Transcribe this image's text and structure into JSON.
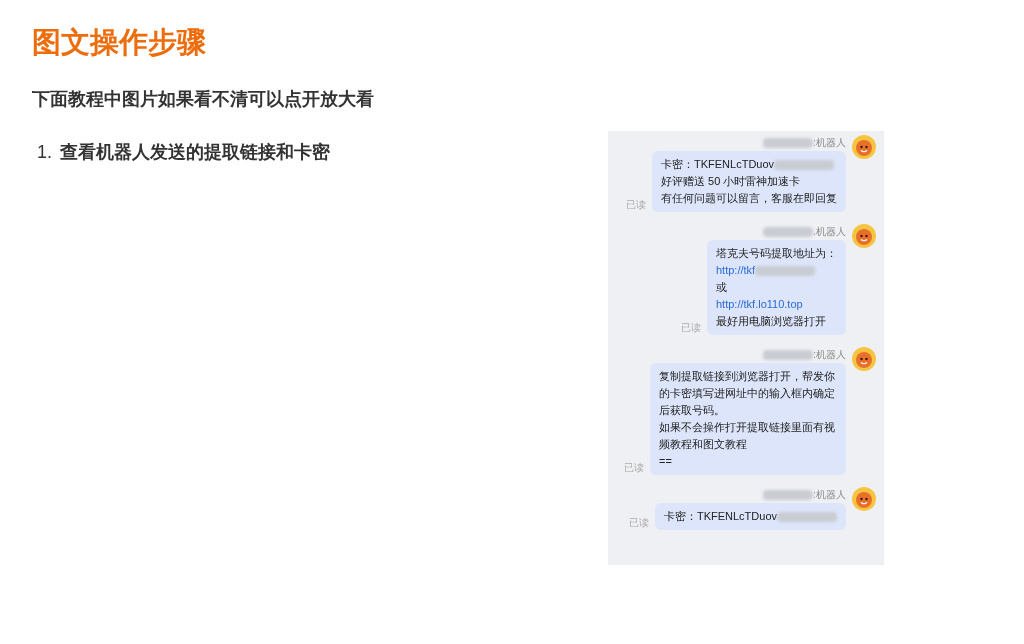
{
  "title": "图文操作步骤",
  "subtitle": "下面教程中图片如果看不清可以点开放大看",
  "steps": [
    {
      "number": "1.",
      "text": "查看机器人发送的提取链接和卡密"
    }
  ],
  "chat": {
    "messages": [
      {
        "sender": ":机器人",
        "sender_redacted": true,
        "read_label": "已读",
        "lines": [
          {
            "kind": "text",
            "text": "卡密：TKFENLcTDuov",
            "redacted_tail": true
          },
          {
            "kind": "text",
            "text": " 好评赠送 50 小时雷神加速卡",
            "redacted_tail": false
          },
          {
            "kind": "text",
            "text": "有任何问题可以留言，客服在即回复",
            "redacted_tail": false
          }
        ]
      },
      {
        "sender": ".机器人",
        "sender_redacted": true,
        "read_label": "已读",
        "lines": [
          {
            "kind": "text",
            "text": "塔克夫号码提取地址为：",
            "redacted_tail": false
          },
          {
            "kind": "link",
            "text": "http://tkf",
            "redacted_tail": true
          },
          {
            "kind": "text",
            "text": "或",
            "redacted_tail": false
          },
          {
            "kind": "link",
            "text": "http://tkf.lo110.top",
            "redacted_tail": false
          },
          {
            "kind": "text",
            "text": "最好用电脑浏览器打开",
            "redacted_tail": false
          }
        ]
      },
      {
        "sender": ":机器人",
        "sender_redacted": true,
        "read_label": "已读",
        "lines": [
          {
            "kind": "text",
            "text": "复制提取链接到浏览器打开，帮发你的卡密填写进网址中的输入框内确定后获取号码。",
            "redacted_tail": false
          },
          {
            "kind": "text",
            "text": "如果不会操作打开提取链接里面有视频教程和图文教程",
            "redacted_tail": false
          },
          {
            "kind": "text",
            "text": "==",
            "redacted_tail": false
          }
        ]
      },
      {
        "sender": ":机器人",
        "sender_redacted": true,
        "read_label": "已读",
        "lines": [
          {
            "kind": "text",
            "text": "卡密：TKFENLcTDuov",
            "redacted_tail": true
          }
        ]
      }
    ]
  }
}
